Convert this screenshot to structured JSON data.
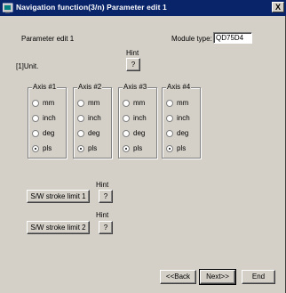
{
  "window": {
    "title": "Navigation function(3/n) Parameter edit 1",
    "close_label": "X"
  },
  "main": {
    "heading": "Parameter edit 1",
    "module_type_label": "Module type:",
    "module_type_value": "QD75D4",
    "hint_label": "Hint",
    "hint_button": "?",
    "unit_label": "[1]Unit."
  },
  "axes": [
    {
      "label": "Axis #1",
      "options": [
        "mm",
        "inch",
        "deg",
        "pls"
      ],
      "selected": "pls"
    },
    {
      "label": "Axis #2",
      "options": [
        "mm",
        "inch",
        "deg",
        "pls"
      ],
      "selected": "pls"
    },
    {
      "label": "Axis #3",
      "options": [
        "mm",
        "inch",
        "deg",
        "pls"
      ],
      "selected": "pls"
    },
    {
      "label": "Axis #4",
      "options": [
        "mm",
        "inch",
        "deg",
        "pls"
      ],
      "selected": "pls"
    }
  ],
  "stroke": {
    "limit1_label": "S/W stroke limit 1",
    "limit2_label": "S/W stroke limit 2",
    "hint_label": "Hint",
    "hint_button": "?"
  },
  "footer": {
    "back_label": "<<Back",
    "next_label": "Next>>",
    "end_label": "End"
  }
}
